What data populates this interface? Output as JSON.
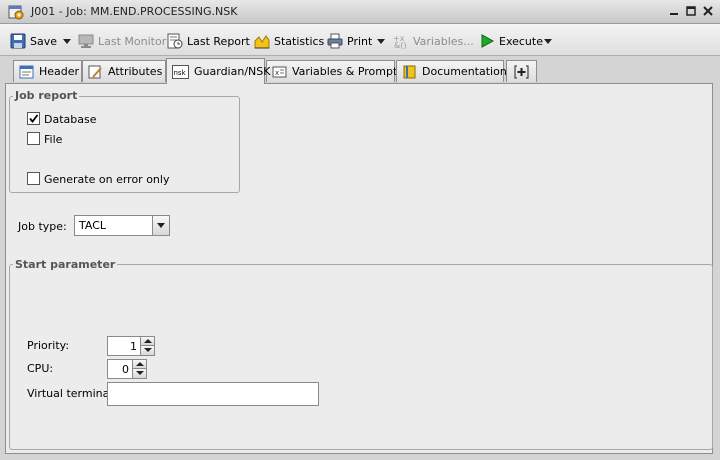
{
  "window": {
    "title": "J001 - Job: MM.END.PROCESSING.NSK"
  },
  "toolbar": {
    "save": "Save",
    "last_monitor": "Last Monitor",
    "last_report": "Last Report",
    "statistics": "Statistics",
    "print": "Print",
    "variables": "Variables...",
    "execute": "Execute"
  },
  "tabs": [
    {
      "label": "Header",
      "icon": "header-icon"
    },
    {
      "label": "Attributes",
      "icon": "attributes-icon"
    },
    {
      "label": "Guardian/NSK",
      "icon": "nsk-icon",
      "icon_text": "nsk",
      "active": true
    },
    {
      "label": "Variables & Prompts",
      "icon": "variables-prompts-icon"
    },
    {
      "label": "Documentation",
      "icon": "documentation-icon"
    },
    {
      "label": "",
      "icon": "add-tab-icon"
    }
  ],
  "job_report": {
    "title": "Job report",
    "database": {
      "label": "Database",
      "checked": true
    },
    "file": {
      "label": "File",
      "checked": false
    },
    "on_error": {
      "label": "Generate on error only",
      "checked": false
    }
  },
  "job_type": {
    "label": "Job type:",
    "value": "TACL"
  },
  "start_parameter": {
    "title": "Start parameter",
    "priority": {
      "label": "Priority:",
      "value": "1"
    },
    "cpu": {
      "label": "CPU:",
      "value": "0"
    },
    "virtual_terminal": {
      "label": "Virtual terminal:",
      "value": ""
    }
  },
  "colors": {
    "execute_green": "#1faa2b",
    "statistics_yellow": "#f2c318",
    "disabled_text": "#8c8c8c"
  }
}
